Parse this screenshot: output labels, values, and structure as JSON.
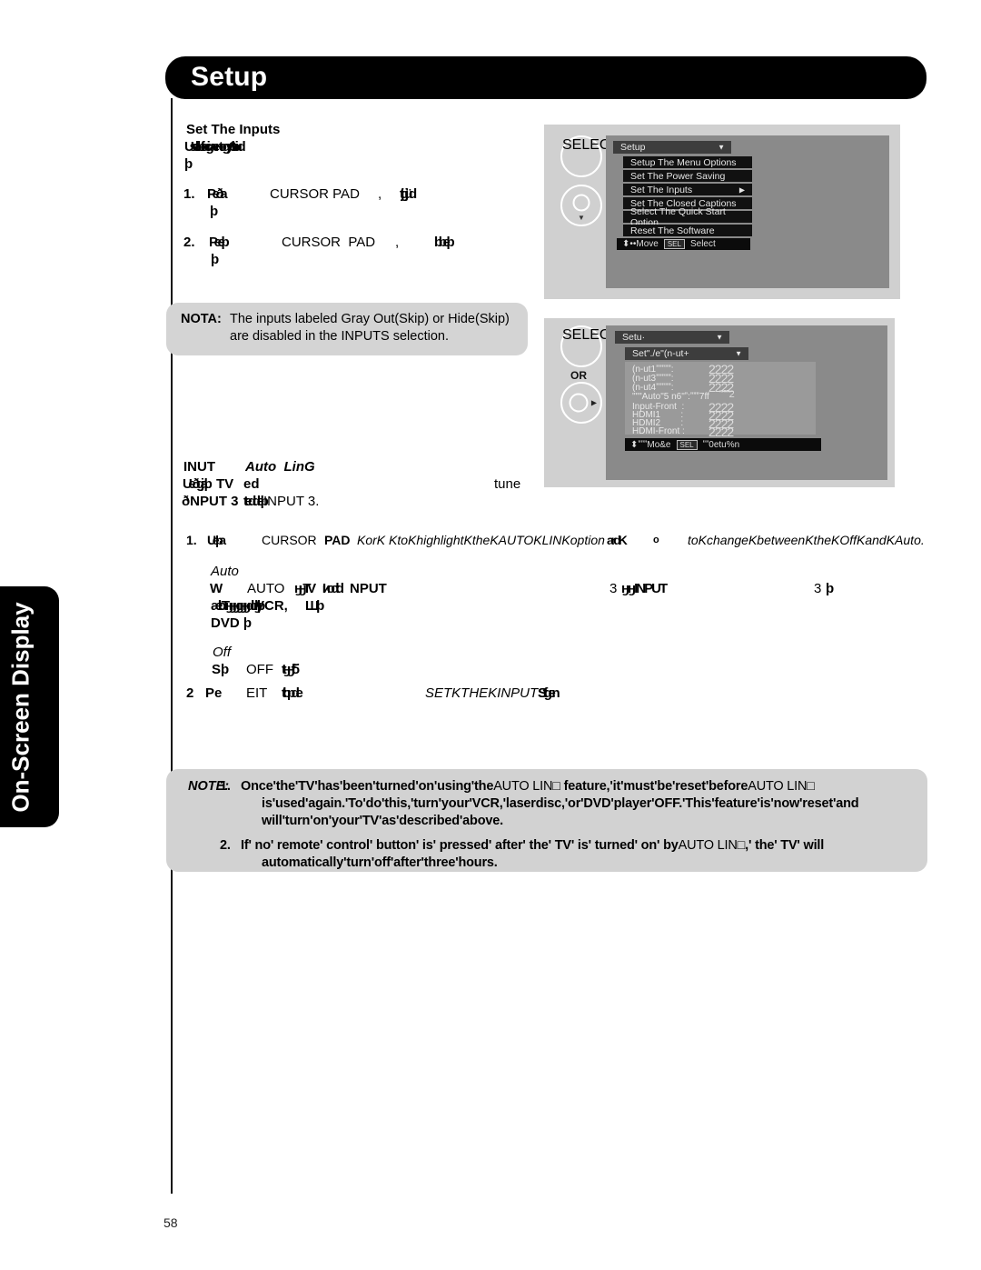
{
  "page": {
    "number": "58",
    "side_tab_label": "On-Screen Display",
    "header_title": "Setup"
  },
  "section": {
    "heading": "Set The Inputs",
    "intro_line1": "Uselabtfocigaentogy6tbiud",
    "intro_line2": "þ",
    "steps": [
      {
        "num": "1.",
        "a": "Peða",
        "control": "CURSOR PAD",
        "comma": ",",
        "tail": "ttjgjiüd",
        "cont": "þ"
      },
      {
        "num": "2.",
        "a": "Peеþ",
        "control": "CURSOR  PAD",
        "comma": ",",
        "tail": "bbеþ",
        "cont": "þ"
      }
    ]
  },
  "nota": {
    "label": "NOTA:",
    "line1": "The inputs labeled Gray Out(Skip) or Hide(Skip)",
    "line2": "are disabled in the INPUTS selection."
  },
  "autolink": {
    "heading_a": "INUT",
    "heading_b": "Auto  LinG",
    "sub_line1_a": "Uеðgjаþ",
    "sub_line1_b": "TV",
    "sub_line1_c": "еd",
    "sub_line1_right": "tune",
    "sub_line2_a": "ðNPUT 3",
    "sub_line2_b": "ttеddеþ",
    "sub_line2_c": "INPUT 3.",
    "step1": {
      "num": "1.",
      "a": "Uеþa",
      "control": "CURSOR",
      "control_b": "PAD",
      "italic1": "KorK KtoKhighlightKtheKAUTOKLINKoption",
      "overlap1": "ardK",
      "mid": "ᴏ",
      "italic2": "toKchangeKbetweenKtheKOffKandKAuto."
    },
    "auto_label": "Auto",
    "auto_line_a": "W",
    "auto_line_b": "AUTO",
    "auto_line_c": "ӈӈТV",
    "auto_line_d": "Iиоdtd",
    "auto_line_e": "NPUT",
    "auto_line_f": "3",
    "auto_line_g": "ӈӈINPUT",
    "auto_line_h": "3",
    "auto_line_i": "þ",
    "auto_line2_a": "ӕtbTӈӈӈgӈӈddӈþ",
    "auto_line2_b": "VCR,",
    "auto_line2_c": "Шþ",
    "auto_line3": "DVD þ",
    "off_label": "Off",
    "off_line_a": "Sþ",
    "off_line_b": "OFF",
    "off_line_c": "ttӈӈfiб",
    "step2": {
      "num": "2",
      "a": "Pе",
      "b": "EIT",
      "c": "ttbрdе",
      "italic": "SETKTHEKINPUTS",
      "overlap": "Ѕtfgеn"
    }
  },
  "note": {
    "label": "NOTE:",
    "items": [
      {
        "num": "1.",
        "l1a": "Once'the'TV'has'been'turned'on'using'the",
        "l1b": "AUTO LIN□",
        "l1c": " feature,'it'must'be'reset'before",
        "l1d": "AUTO LIN□",
        "l2": "is'used'again.'To'do'this,'turn'your'VCR,'laserdisc,'or'DVD'player'OFF.'This'feature'is'now'reset'and",
        "l3": "will'turn'on'your'TV'as'described'above."
      },
      {
        "num": "2.",
        "l1a": "If' no' remote' control' button' is' pressed' after' the' TV' is' turned' on' by",
        "l1b": "AUTO  LIN□",
        "l1c": ",' the' TV' will",
        "l2": "automatically'turn'off'after'three'hours."
      }
    ]
  },
  "osd_top": {
    "remote": {
      "select_label": "SELECT",
      "pad_caret": "▼"
    },
    "menu_title": "Setup",
    "caret": "▼",
    "items": [
      {
        "label": "Setup The Menu Options",
        "arrow": ""
      },
      {
        "label": "Set The Power Saving",
        "arrow": ""
      },
      {
        "label": "Set The Inputs",
        "arrow": "▶"
      },
      {
        "label": "Set The Closed Captions",
        "arrow": ""
      },
      {
        "label": "Select The Quick Start Option",
        "arrow": ""
      },
      {
        "label": "Reset The Software",
        "arrow": ""
      }
    ],
    "footer": {
      "move": "⬍••Move",
      "key": "SEL",
      "select": "Select"
    }
  },
  "osd_bottom": {
    "remote": {
      "select_label": "SELECT",
      "or_label": "OR",
      "pad_caret": "▶"
    },
    "menu_title": "Setu·",
    "submenu_title": "Set\"./e\"(n-ut+",
    "caret": "▼",
    "rows": [
      {
        "label": "(n-ut1ˮˮˮˮˮ:",
        "value": "2222"
      },
      {
        "label": "(n-ut3ˮˮˮˮˮ:",
        "value": "2222"
      },
      {
        "label": "(n-ut4ˮˮˮˮˮ:",
        "value": "2222"
      },
      {
        "label": "\"\"\"Auto\"5 n6\"ˮ:ˮˮˮ7ff",
        "value": "ˮˮˮˮ2"
      },
      {
        "label": "Input-Front  :",
        "value": "2222"
      },
      {
        "label": "HDMI1        :",
        "value": "2222"
      },
      {
        "label": "HDMI2        :",
        "value": "2222"
      },
      {
        "label": "HDMI-Front :",
        "value": "2222"
      }
    ],
    "footer": {
      "move": "⬍ˮˮˮMo&e",
      "key": "SEL",
      "select": "ˮˮ0etu%n"
    }
  },
  "colors": {
    "ink": "#000000",
    "paper": "#ffffff",
    "callout_gray": "#d2d2d2",
    "osd_frame": "#d0d0d0",
    "osd_screen": "#8a8a8a",
    "osd_panel": "#9a9a9a",
    "menu_item_bg": "#111111"
  }
}
